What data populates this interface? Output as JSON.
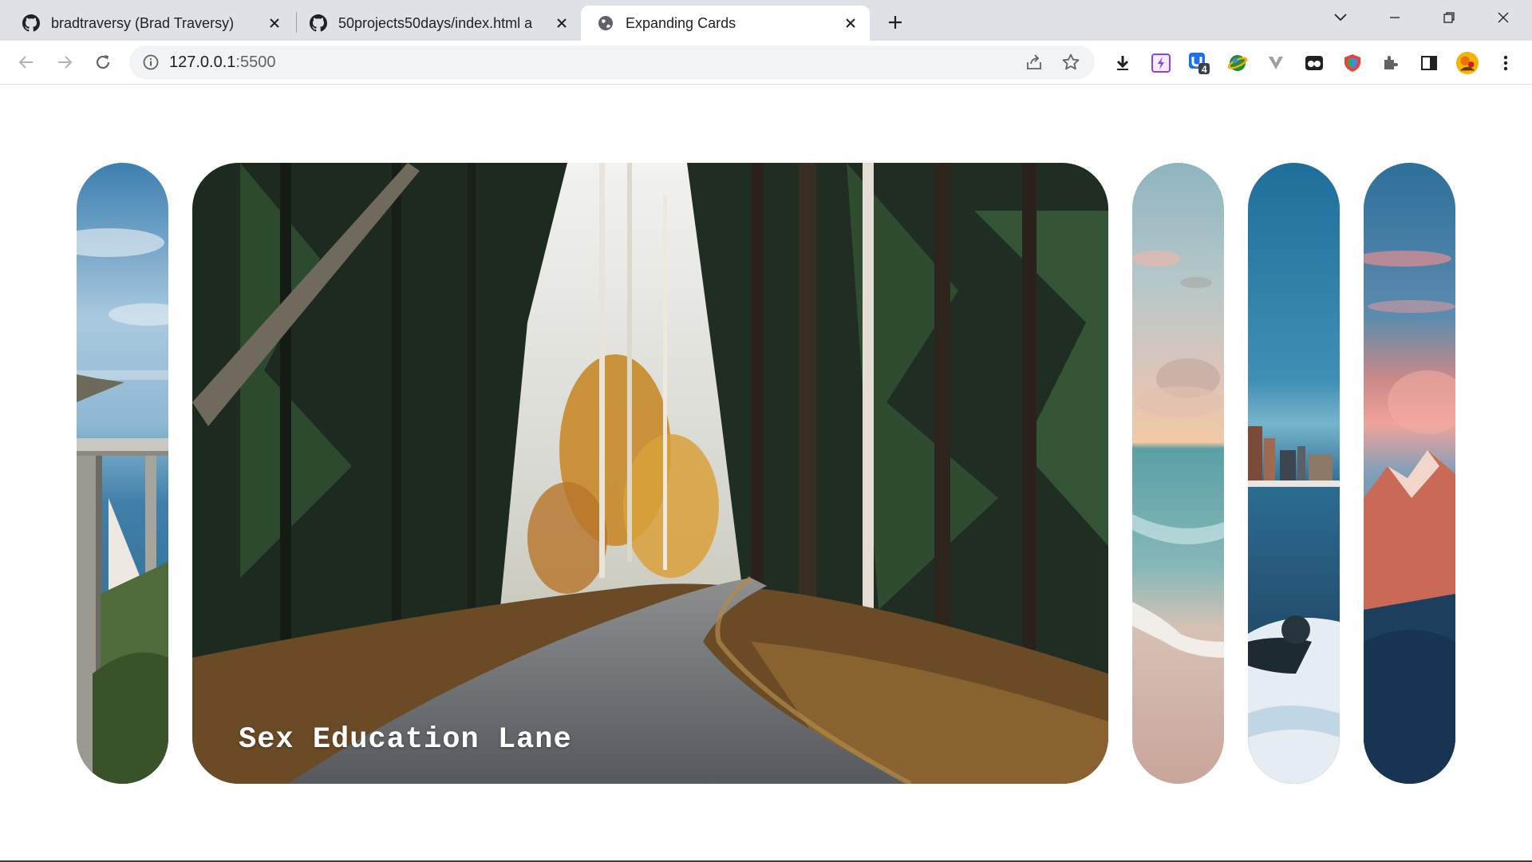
{
  "browser": {
    "tabs": [
      {
        "title": "bradtraversy (Brad Traversy)",
        "icon": "github-icon"
      },
      {
        "title": "50projects50days/index.html a",
        "icon": "github-icon"
      },
      {
        "title": "Expanding Cards",
        "icon": "globe-icon"
      }
    ],
    "url_host": "127.0.0.1",
    "url_port": ":5500",
    "extension_badge": "4",
    "accent": "#1a73e8"
  },
  "page": {
    "panels": [
      {
        "name": "coastal-bridge",
        "title": "",
        "active": false
      },
      {
        "name": "forest-road",
        "title": "Sex Education Lane",
        "active": true
      },
      {
        "name": "beach-sunset",
        "title": "",
        "active": false
      },
      {
        "name": "city-lake",
        "title": "",
        "active": false
      },
      {
        "name": "mountain-dusk",
        "title": "",
        "active": false
      }
    ]
  }
}
